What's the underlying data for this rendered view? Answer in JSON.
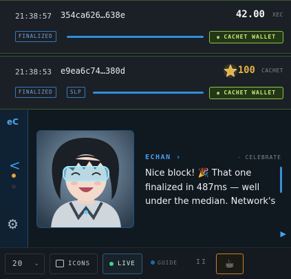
{
  "transactions": [
    {
      "time": "21:38:57",
      "hash": "354ca626…638e",
      "amount": "42.00",
      "unit": "XEC",
      "badges": [
        "FINALIZED"
      ],
      "wallet_label": "CACHET WALLET"
    },
    {
      "time": "21:38:53",
      "hash": "e9ea6c74…380d",
      "amount": "100",
      "unit": "CACHET",
      "badges": [
        "FINALIZED",
        "SLP"
      ],
      "wallet_label": "CACHET WALLET",
      "token_icon": "star-icon"
    }
  ],
  "sidebar": {
    "logo": "eC",
    "nav_icon": "chevron-left-icon",
    "settings_icon": "gear-icon"
  },
  "chat": {
    "author": "ECHAN ›",
    "tag": "· CELEBRATE",
    "message": "Nice block! 🎉 That one finalized in 487ms — well under the median. Network's",
    "next_icon": "play-icon"
  },
  "toolbar": {
    "count_value": "20",
    "icons_label": "ICONS",
    "live_label": "LIVE",
    "guide_label": "GUIDE",
    "pause_label": "II",
    "coffee_icon": "☕"
  },
  "colors": {
    "accent_blue": "#2f8fe0",
    "wallet_green": "#8ec84a",
    "token_gold": "#e7b43a",
    "live_green": "#3fd48a"
  }
}
